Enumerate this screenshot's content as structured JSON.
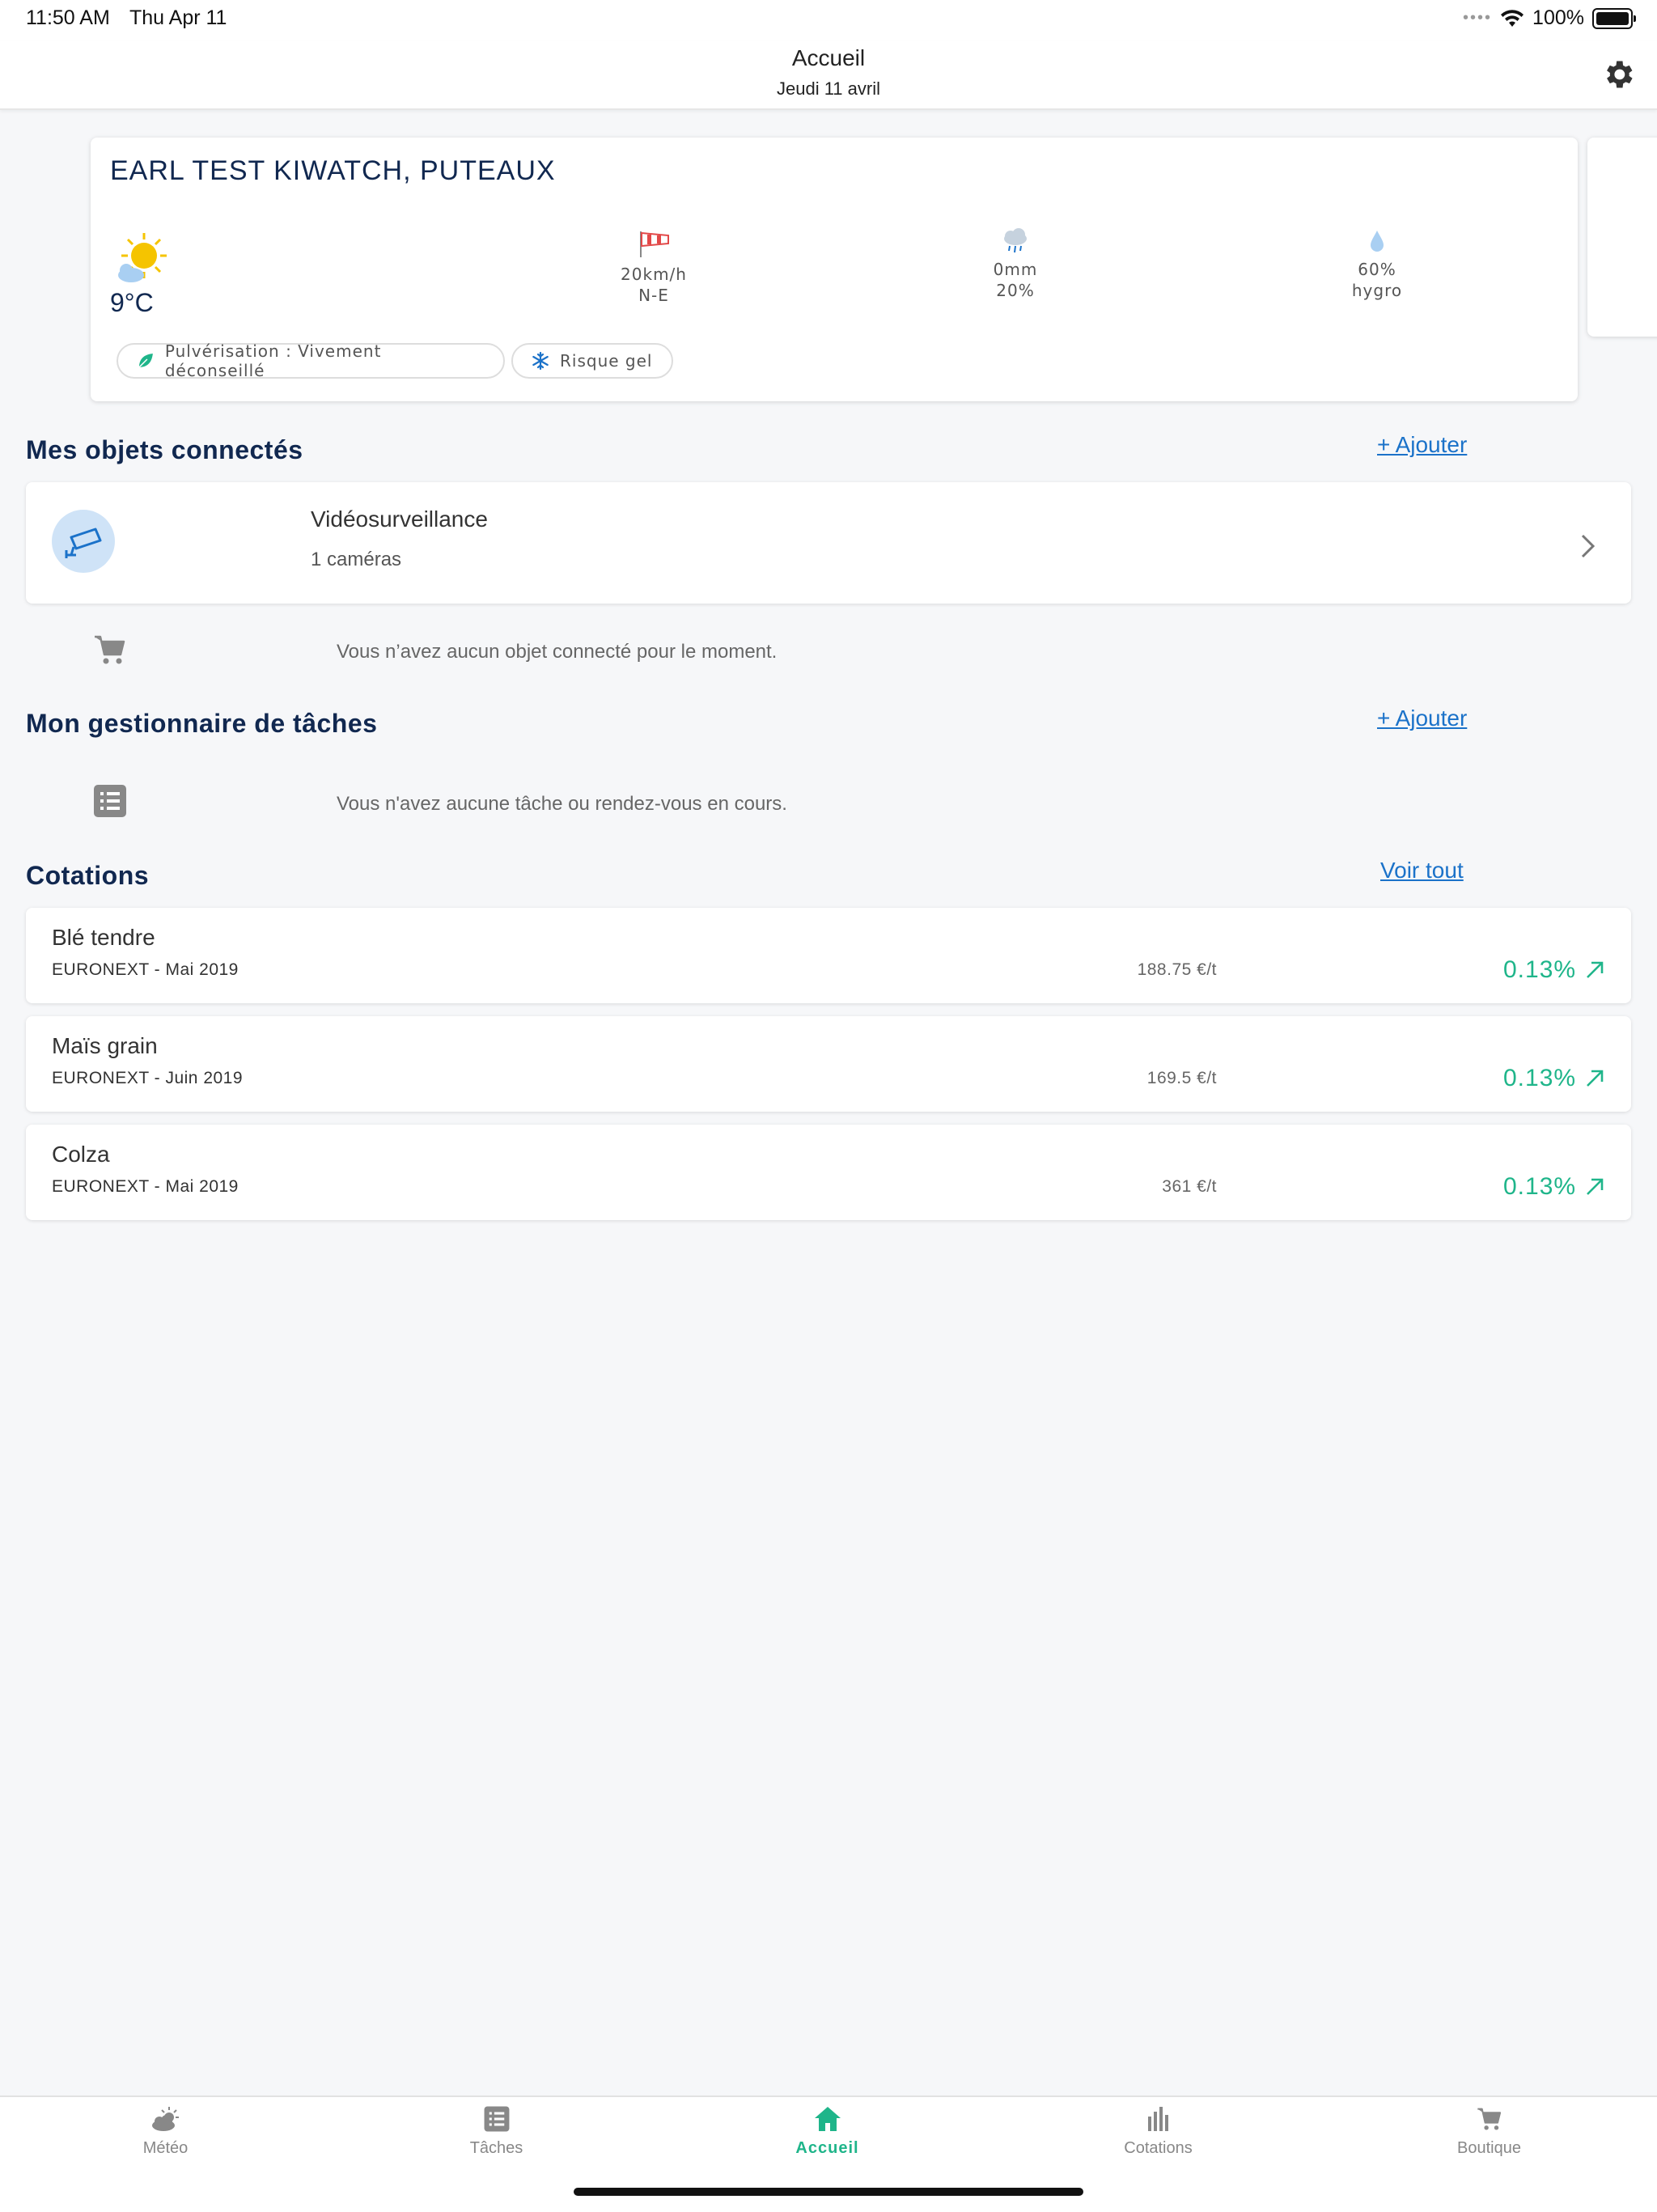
{
  "status_bar": {
    "time": "11:50 AM",
    "date": "Thu Apr 11",
    "battery": "100%",
    "signal_dots": "••••"
  },
  "header": {
    "title": "Accueil",
    "subtitle": "Jeudi 11 avril",
    "settings_icon": "gear-icon"
  },
  "weather": {
    "farm_name": "EARL TEST KIWATCH, PUTEAUX",
    "temperature": "9°C",
    "condition_icon": "sun-cloud-icon",
    "wind": {
      "speed": "20km/h",
      "direction": "N-E",
      "icon": "windsock-icon"
    },
    "rain": {
      "amount": "0mm",
      "probability": "20%",
      "icon": "rain-cloud-icon"
    },
    "humidity": {
      "value": "60%",
      "label": "hygro",
      "icon": "droplet-icon"
    },
    "chips": [
      {
        "label": "Pulvérisation : Vivement déconseillé",
        "icon": "leaf-icon",
        "color": "#1fb58a"
      },
      {
        "label": "Risque gel",
        "icon": "snowflake-icon",
        "color": "#1b72c9"
      }
    ]
  },
  "connected_objects": {
    "title": "Mes objets connectés",
    "add_label": "+ Ajouter",
    "items": [
      {
        "name": "Vidéosurveillance",
        "detail": "1 caméras",
        "icon": "security-camera-icon"
      }
    ],
    "empty_text": "Vous n’avez aucun objet connecté pour le moment.",
    "empty_icon": "cart-icon"
  },
  "tasks": {
    "title": "Mon gestionnaire de tâches",
    "add_label": "+ Ajouter",
    "empty_text": "Vous n'avez aucune tâche ou rendez-vous en cours.",
    "empty_icon": "list-icon"
  },
  "cotations": {
    "title": "Cotations",
    "see_all_label": "Voir tout",
    "items": [
      {
        "name": "Blé tendre",
        "market": "EURONEXT - Mai 2019",
        "price": "188.75 €/t",
        "change": "0.13%",
        "trend": "up"
      },
      {
        "name": "Maïs grain",
        "market": "EURONEXT - Juin 2019",
        "price": "169.5 €/t",
        "change": "0.13%",
        "trend": "up"
      },
      {
        "name": "Colza",
        "market": "EURONEXT - Mai 2019",
        "price": "361 €/t",
        "change": "0.13%",
        "trend": "up"
      }
    ]
  },
  "tab_bar": {
    "active": "Accueil",
    "accent_color": "#1fb58a",
    "tabs": [
      {
        "label": "Météo",
        "icon": "weather-icon"
      },
      {
        "label": "Tâches",
        "icon": "list-icon"
      },
      {
        "label": "Accueil",
        "icon": "home-icon"
      },
      {
        "label": "Cotations",
        "icon": "bar-chart-icon"
      },
      {
        "label": "Boutique",
        "icon": "cart-icon"
      }
    ]
  }
}
